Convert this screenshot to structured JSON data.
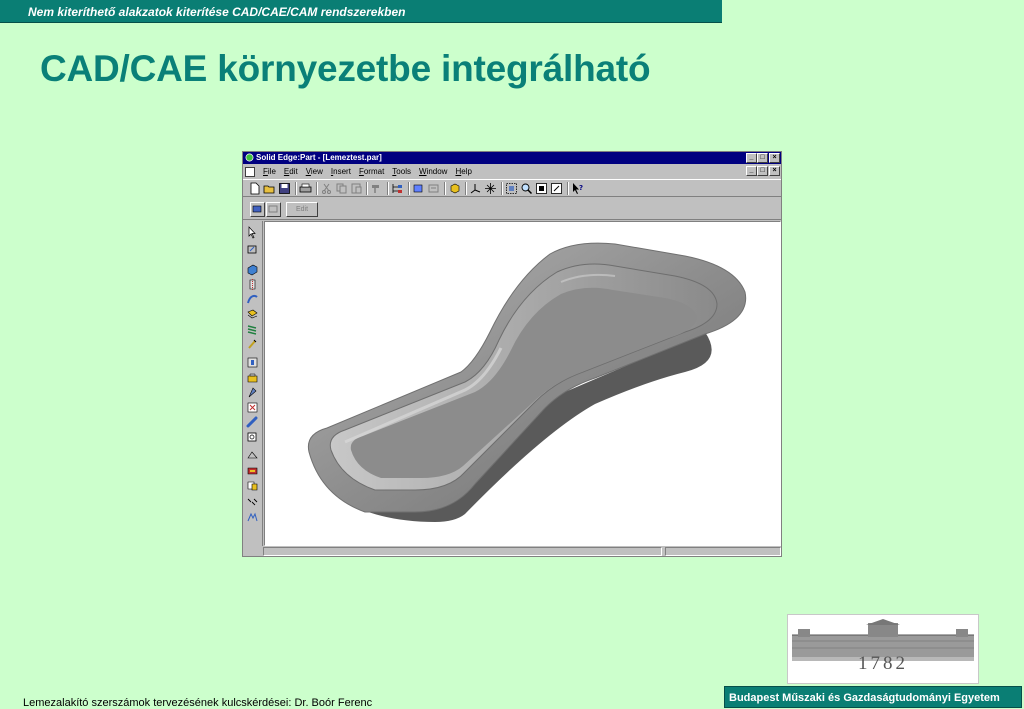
{
  "slide": {
    "banner": "Nem kiteríthető alakzatok kiterítése CAD/CAE/CAM  rendszerekben",
    "title": "CAD/CAE környezetbe integrálható",
    "footer_left": "Lemezalakító szerszámok tervezésének kulcskérdései: Dr. Boór Ferenc",
    "footer_right": "Budapest Műszaki és Gazdaságtudományi Egyetem",
    "logo_year": "1782"
  },
  "window": {
    "title": "Solid Edge:Part - [Lemeztest.par]",
    "controls": [
      "_",
      "□",
      "×"
    ],
    "menu": [
      "File",
      "Edit",
      "View",
      "Insert",
      "Format",
      "Tools",
      "Window",
      "Help"
    ],
    "edit_label": "Edit"
  },
  "colors": {
    "background": "#ccffcc",
    "accent": "#0a7e74",
    "title": "#0a8078",
    "win_title": "#000080"
  }
}
